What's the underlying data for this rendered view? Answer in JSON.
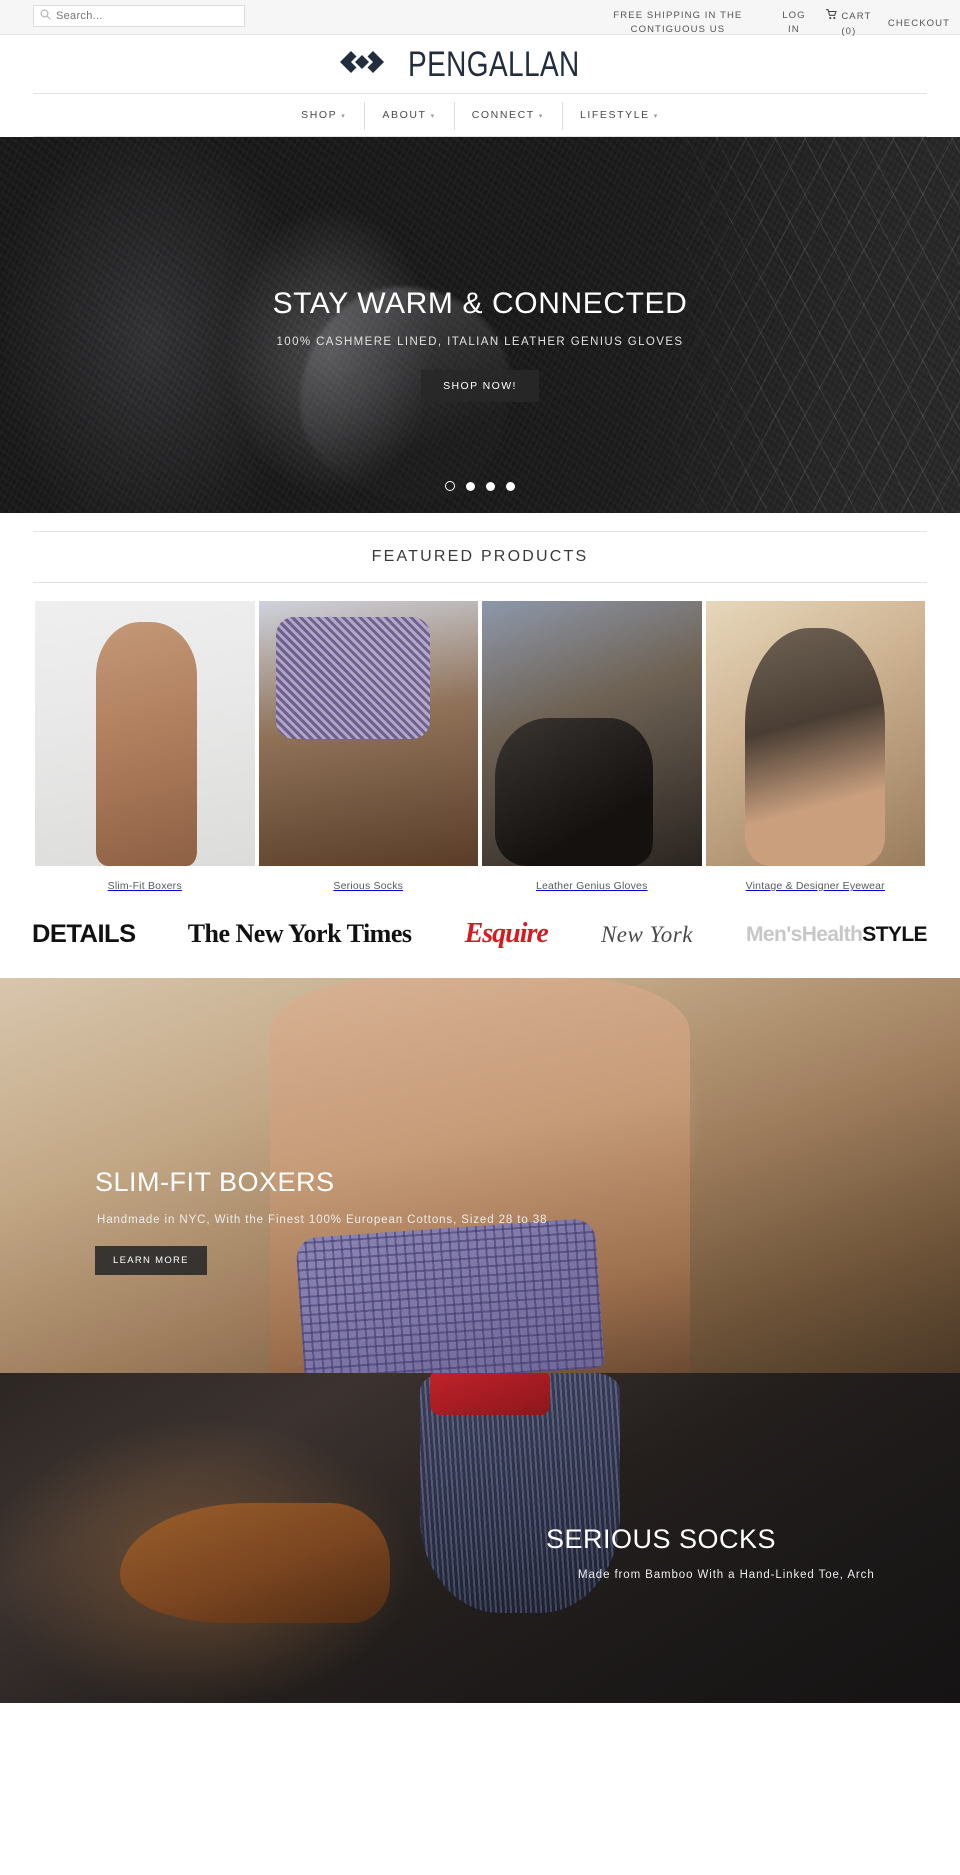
{
  "utility": {
    "search_placeholder": "Search...",
    "search_value": "",
    "shipping_notice": "FREE SHIPPING IN THE CONTIGUOUS US",
    "login": "LOG IN",
    "cart": "CART",
    "cart_count": "(0)",
    "checkout": "CHECKOUT"
  },
  "brand": {
    "name": "PENGALLAN"
  },
  "nav": {
    "items": [
      {
        "label": "SHOP",
        "caret": "▾"
      },
      {
        "label": "ABOUT",
        "caret": "▾"
      },
      {
        "label": "CONNECT",
        "caret": "▾"
      },
      {
        "label": "LIFESTYLE",
        "caret": "▾"
      }
    ]
  },
  "hero": {
    "title": "STAY WARM & CONNECTED",
    "subtitle": "100% CASHMERE LINED, ITALIAN LEATHER GENIUS GLOVES",
    "button": "SHOP NOW!",
    "slides": 4,
    "active_slide": 1
  },
  "featured": {
    "title": "FEATURED PRODUCTS",
    "products": [
      {
        "name": "Slim-Fit Boxers"
      },
      {
        "name": "Serious Socks"
      },
      {
        "name": "Leather Genius Gloves"
      },
      {
        "name": "Vintage & Designer Eyewear"
      }
    ]
  },
  "press": {
    "logos": [
      {
        "name": "DETAILS"
      },
      {
        "name": "The New York Times"
      },
      {
        "name": "Esquire"
      },
      {
        "name": "New York"
      },
      {
        "name": "Men'sHealth",
        "suffix": "STYLE"
      }
    ]
  },
  "banners": [
    {
      "title": "SLIM-FIT BOXERS",
      "subtitle": "Handmade in NYC, With the Finest 100% European Cottons, Sized 28 to 38",
      "button": "LEARN MORE"
    },
    {
      "title": "SERIOUS SOCKS",
      "subtitle": "Made from Bamboo With a Hand-Linked Toe, Arch"
    }
  ],
  "colors": {
    "brand_navy": "#222d3d",
    "esquire_red": "#d61b20",
    "bar_bg": "#f6f6f6"
  }
}
